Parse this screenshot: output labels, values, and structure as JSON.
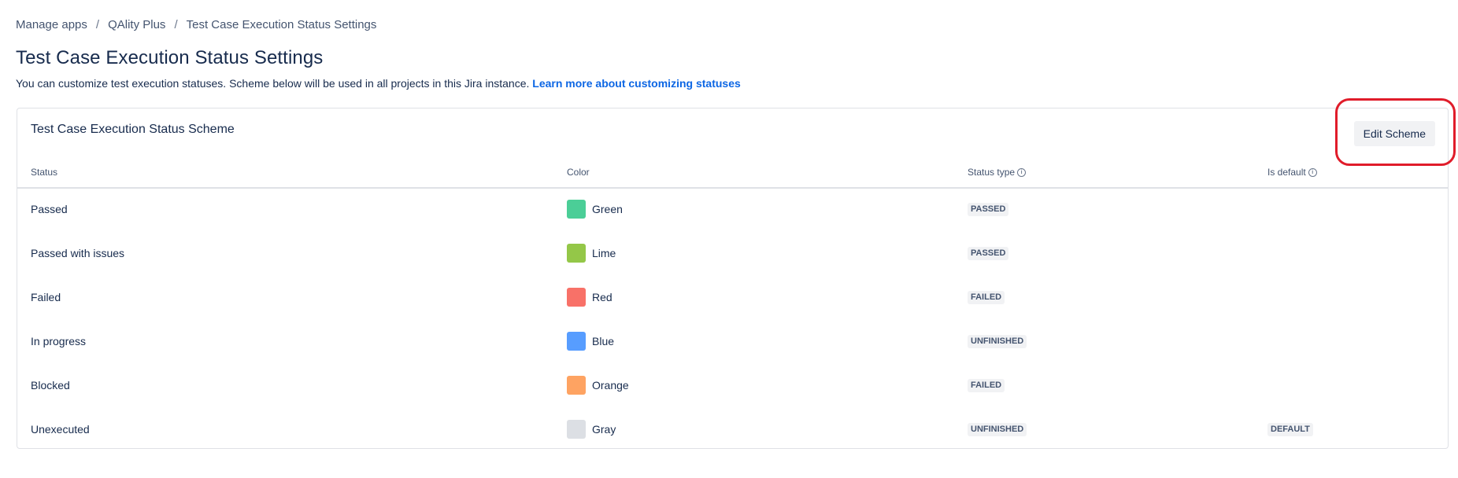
{
  "breadcrumb": {
    "items": [
      "Manage apps",
      "QAlity Plus",
      "Test Case Execution Status Settings"
    ],
    "separator": "/"
  },
  "page": {
    "title": "Test Case Execution Status Settings",
    "description": "You can customize test execution statuses. Scheme below will be used in all projects in this Jira instance.",
    "learn_more_link": "Learn more about customizing statuses"
  },
  "scheme": {
    "title": "Test Case Execution Status Scheme",
    "edit_button": "Edit Scheme",
    "columns": {
      "status": "Status",
      "color": "Color",
      "status_type": "Status type",
      "is_default": "Is default"
    },
    "rows": [
      {
        "status": "Passed",
        "color_name": "Green",
        "color_hex": "#4bce97",
        "status_type": "PASSED",
        "is_default": ""
      },
      {
        "status": "Passed with issues",
        "color_name": "Lime",
        "color_hex": "#94c748",
        "status_type": "PASSED",
        "is_default": ""
      },
      {
        "status": "Failed",
        "color_name": "Red",
        "color_hex": "#f87168",
        "status_type": "FAILED",
        "is_default": ""
      },
      {
        "status": "In progress",
        "color_name": "Blue",
        "color_hex": "#579dff",
        "status_type": "UNFINISHED",
        "is_default": ""
      },
      {
        "status": "Blocked",
        "color_name": "Orange",
        "color_hex": "#fea362",
        "status_type": "FAILED",
        "is_default": ""
      },
      {
        "status": "Unexecuted",
        "color_name": "Gray",
        "color_hex": "#dcdfe4",
        "status_type": "UNFINISHED",
        "is_default": "DEFAULT"
      }
    ]
  },
  "colors": {
    "link": "#0c66e4",
    "text": "#172b4d",
    "highlight": "#e01c2a"
  }
}
